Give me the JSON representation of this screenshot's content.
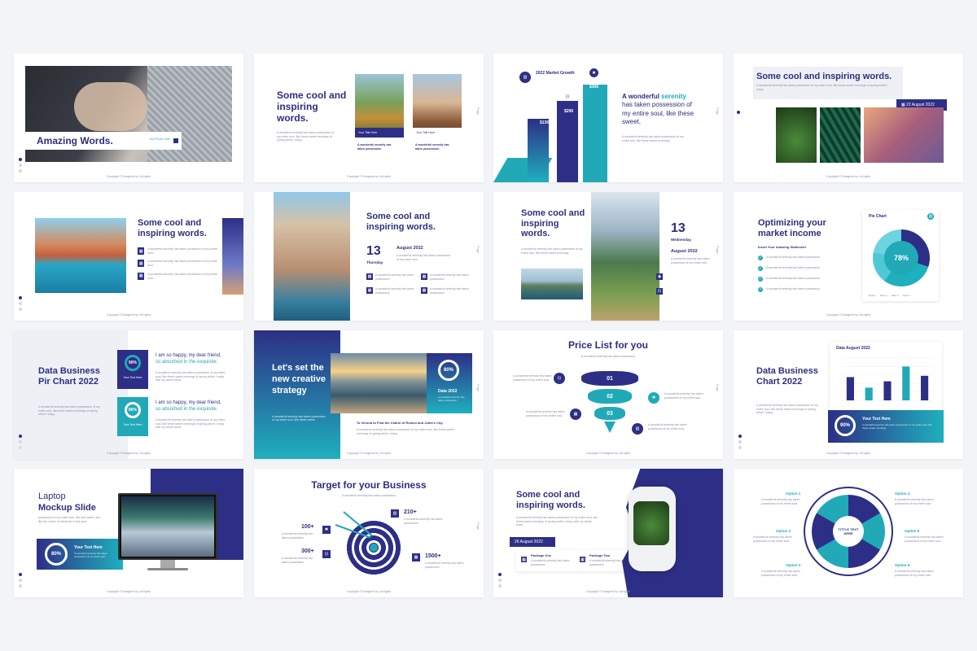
{
  "colors": {
    "navy": "#2d2f86",
    "teal": "#21a9b8",
    "text": "#2d2f7f"
  },
  "copyright": "Copyright © Designed by: All rights",
  "page_label": "Page",
  "s1": {
    "title": "Amazing Words.",
    "tag": "Your Photo Here"
  },
  "s2": {
    "title": "Some cool and inspiring words.",
    "body": "A wonderful serenity has taken possession of my entire soul, like these sweet mornings of spring which I enjoy.",
    "cap1": "Your Title Here",
    "cap2": "Your Title Here",
    "sub1": "A wonderful serenity has taken possession",
    "sub2": "A wonderful serenity has taken possession"
  },
  "s3": {
    "title": "2022 Market Growth",
    "v1": "$136",
    "v2": "$296",
    "v3": "$366",
    "head_a": "A wonderful",
    "head_b": "serenity",
    "head_c": "has taken possession of my entire soul, like these sweet.",
    "body": "A wonderful serenity has taken possession of my entire soul. like these sweet mornings."
  },
  "s4": {
    "title": "Some cool and inspiring words.",
    "body": "A wonderful serenity has taken possession of my entire soul, like these sweet mornings of spring which I enjoy.",
    "date": "22 August 2022"
  },
  "s5": {
    "title": "Some cool and inspiring words.",
    "items": [
      "A wonderful serenity has taken possession of my entire soul.",
      "A wonderful serenity has taken possession of my entire soul.",
      "A wonderful serenity has taken possession of my entire soul."
    ]
  },
  "s6": {
    "title": "Some cool and inspiring words.",
    "day": "13",
    "weekday": "Thursday",
    "month": "August 2022",
    "body": "A wonderful serenity has taken possession of my entire soul.",
    "items": [
      "A wonderful serenity has taken possession",
      "A wonderful serenity has taken possession",
      "A wonderful serenity has taken possession",
      "A wonderful serenity has taken possession"
    ]
  },
  "s7": {
    "title": "Some cool and inspiring words.",
    "body": "A wonderful serenity has taken possession of my entire soul. like these sweet mornings.",
    "day": "13",
    "weekday": "Wednesday",
    "month": "August 2022",
    "sub": "A wonderful serenity has taken possession of my entire soul."
  },
  "s8": {
    "title": "Optimizing your market income",
    "sub": "Insert Your Amazing Statement",
    "items": [
      "A wonderful serenity has taken possession",
      "A wonderful serenity has taken possession",
      "A wonderful serenity has taken possession",
      "A wonderful serenity has taken possession"
    ],
    "chart_title": "Pie Chart",
    "pct": "78%",
    "legend": [
      "Data 1",
      "Data 2",
      "Data 3",
      "Data 4"
    ]
  },
  "s9": {
    "title": "Data Business Pir Chart 2022",
    "body": "A wonderful serenity has taken possession of my entire soul, like these sweet mornings of spring which I enjoy.",
    "p1": "90%",
    "p2": "86%",
    "cap": "Your Text Here",
    "cap2": "Your Text Here",
    "h1_a": "I am so happy, my dear friend,",
    "h1_b": "so absorbed in the exquisite.",
    "h2_a": "I am so happy, my dear friend,",
    "h2_b": "so absorbed in the exquisite.",
    "t": "A wonderful serenity has taken possession of my entire soul, like these sweet mornings of spring which I enjoy with my whole heart."
  },
  "s10": {
    "title": "Let's set the new creative strategy",
    "body": "A wonderful serenity has taken possession of my entire soul, like these sweet.",
    "pct": "80%",
    "data": "Data 2022",
    "data_body": "A wonderful serenity has taken possession",
    "cap": "To Verona to Find the Charm of Romeo and Juliet's City.",
    "cap_body": "A wonderful serenity has taken possession of my entire soul, like these sweet mornings of spring which I enjoy."
  },
  "s11": {
    "title": "Price List for you",
    "sub": "A wonderful serenity has taken possession",
    "n1": "01",
    "n2": "02",
    "n3": "03",
    "items": [
      "A wonderful serenity has taken possession of my entire soul.",
      "A wonderful serenity has taken possession of my entire soul.",
      "A wonderful serenity has taken possession of my entire soul.",
      "A wonderful serenity has taken possession of my entire soul."
    ]
  },
  "s12": {
    "title": "Data Business Chart 2022",
    "body": "A wonderful serenity has taken possession of my entire soul, like these sweet mornings of spring which I enjoy.",
    "chart_title": "Data August 2022",
    "pct": "90%",
    "cap": "Your Text Here",
    "cap_body": "A wonderful serenity has taken possession of my entire soul, like these sweet mornings."
  },
  "chart_data": {
    "type": "bar",
    "title": "Data August 2022",
    "categories": [
      "",
      "",
      "",
      "",
      ""
    ],
    "values": [
      55,
      30,
      45,
      80,
      58
    ],
    "ylim": [
      0,
      100
    ]
  },
  "s13": {
    "title_a": "Laptop",
    "title_b": "Mockup Slide",
    "body": "possession of my entire soul, like and sweet, and like the charm of existence in this spot.",
    "pct": "80%",
    "cap": "Your Text Here",
    "cap_body": "A wonderful serenity has taken possession of my entire soul."
  },
  "s14": {
    "title": "Target for your Business",
    "sub": "A wonderful serenity has taken possession",
    "stats": [
      {
        "v": "100+",
        "t": "A wonderful serenity has taken possession"
      },
      {
        "v": "300+",
        "t": "A wonderful serenity has taken possession"
      },
      {
        "v": "210+",
        "t": "A wonderful serenity has taken possession"
      },
      {
        "v": "1500+",
        "t": "A wonderful serenity has taken possession"
      }
    ]
  },
  "s15": {
    "title": "Some cool and inspiring words.",
    "body": "A wonderful serenity has taken possession of my entire soul, like these sweet mornings of spring which I enjoy with my whole heart.",
    "date": "26 August 2022",
    "p1": "Package One",
    "p2": "Package Two",
    "p_body": "A wonderful serenity has taken possession"
  },
  "s16": {
    "center": "TITTLE TEXT HERE",
    "options": [
      "Option 1",
      "Option 2",
      "Option 3",
      "Option 4",
      "Option 5",
      "Option 6"
    ],
    "body": "A wonderful serenity has taken possession of my entire soul."
  }
}
